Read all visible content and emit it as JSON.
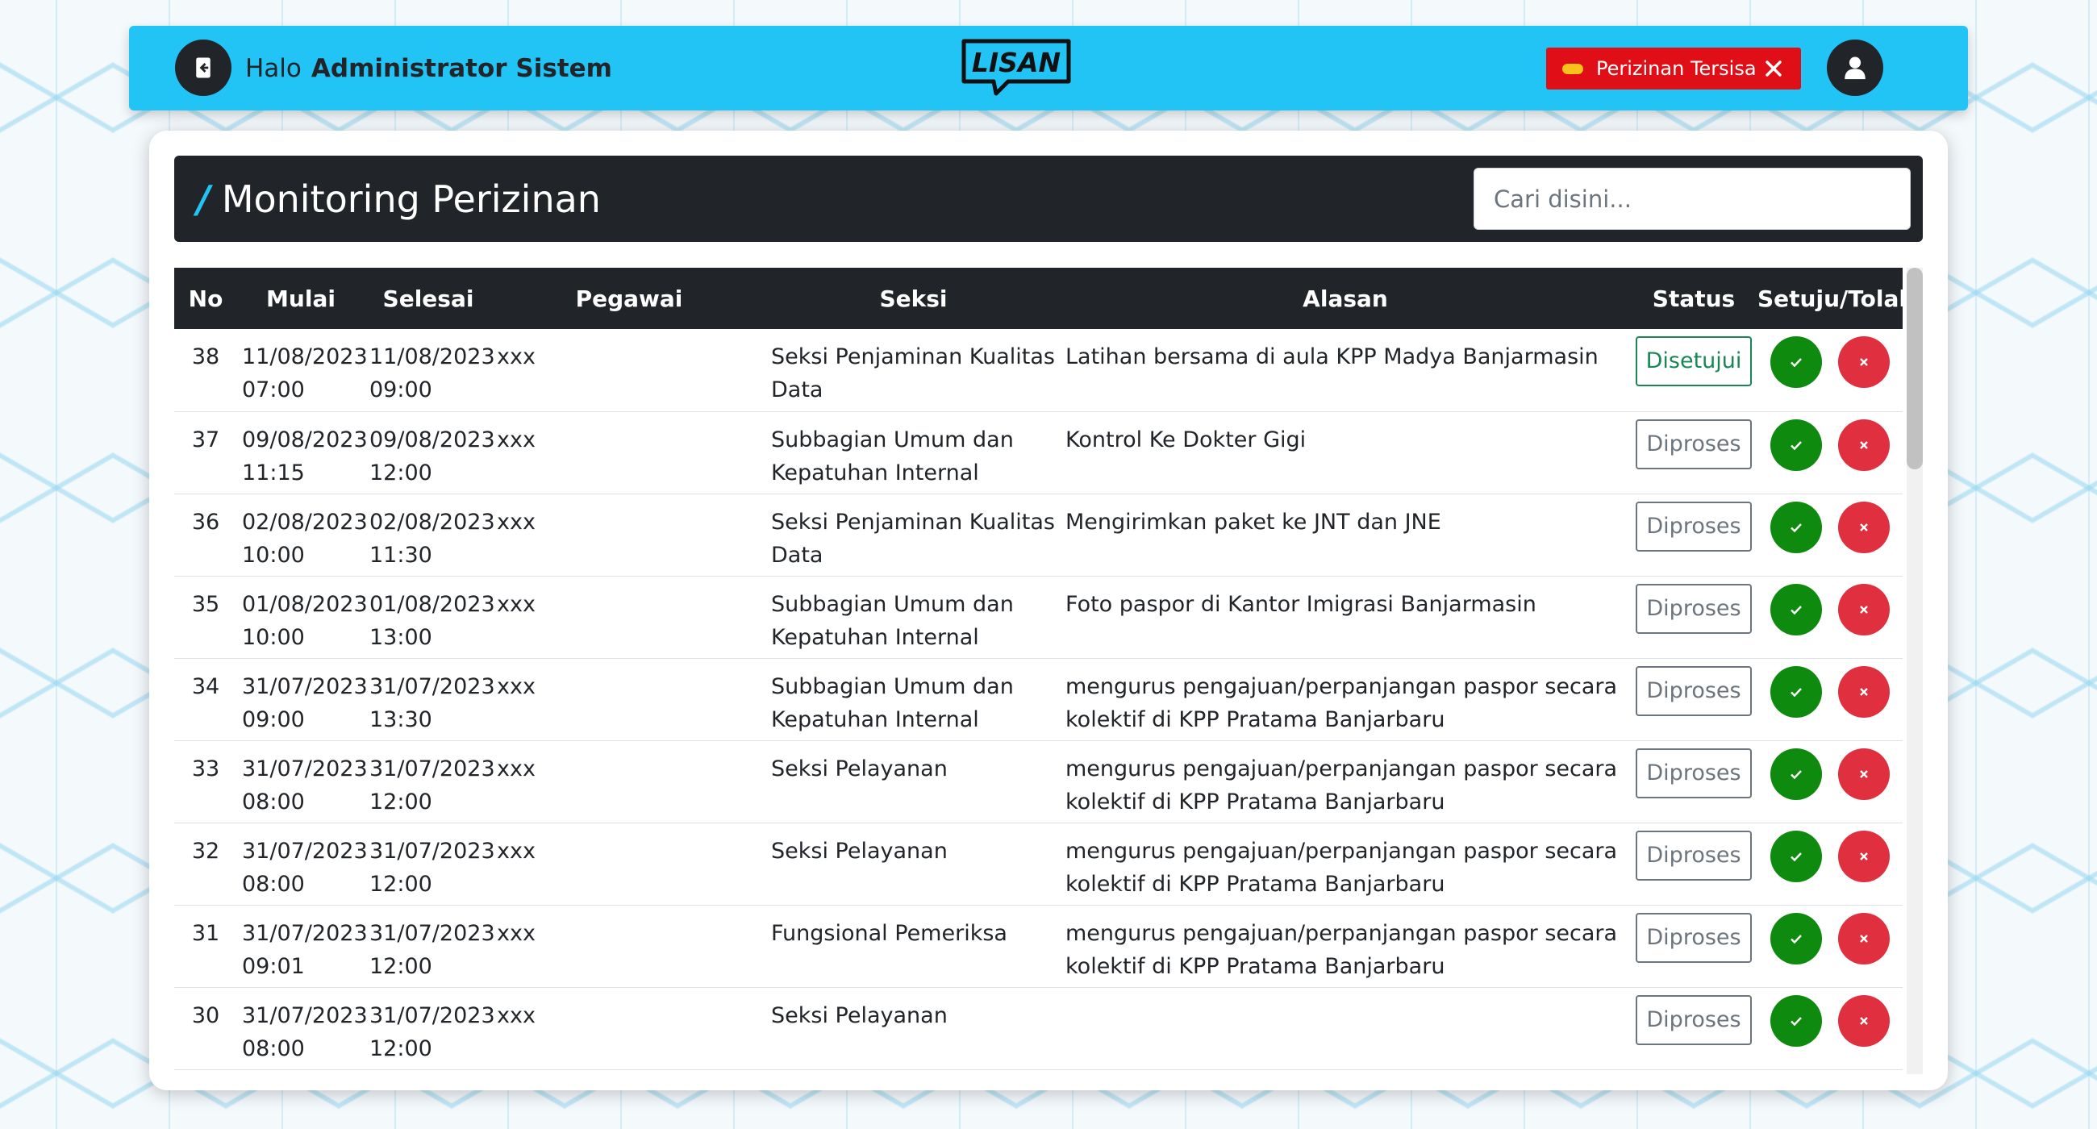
{
  "navbar": {
    "greeting": "Halo",
    "user_name": "Administrator Sistem",
    "logo_text": "LISAN",
    "alert_label": "Perizinan Tersisa",
    "colors": {
      "bar": "#22c4f5",
      "alert": "#e00f17",
      "dark": "#212529"
    }
  },
  "page": {
    "title": "Monitoring Perizinan",
    "search_placeholder": "Cari disini..."
  },
  "table": {
    "headers": {
      "no": "No",
      "mulai": "Mulai",
      "selesai": "Selesai",
      "pegawai": "Pegawai",
      "seksi": "Seksi",
      "alasan": "Alasan",
      "status": "Status",
      "action": "Setuju/Tolak"
    },
    "rows": [
      {
        "no": "38",
        "mulai_date": "11/08/2023",
        "mulai_time": "07:00",
        "selesai_date": "11/08/2023",
        "selesai_time": "09:00",
        "pegawai": "xxx",
        "seksi": "Seksi Penjaminan Kualitas Data",
        "alasan": "Latihan bersama  di aula KPP Madya Banjarmasin",
        "status": "Disetujui"
      },
      {
        "no": "37",
        "mulai_date": "09/08/2023",
        "mulai_time": "11:15",
        "selesai_date": "09/08/2023",
        "selesai_time": "12:00",
        "pegawai": "xxx",
        "seksi": "Subbagian Umum dan Kepatuhan Internal",
        "alasan": "Kontrol Ke Dokter Gigi",
        "status": "Diproses"
      },
      {
        "no": "36",
        "mulai_date": "02/08/2023",
        "mulai_time": "10:00",
        "selesai_date": "02/08/2023",
        "selesai_time": "11:30",
        "pegawai": "xxx",
        "seksi": "Seksi Penjaminan Kualitas Data",
        "alasan": "Mengirimkan paket ke JNT dan JNE",
        "status": "Diproses"
      },
      {
        "no": "35",
        "mulai_date": "01/08/2023",
        "mulai_time": "10:00",
        "selesai_date": "01/08/2023",
        "selesai_time": "13:00",
        "pegawai": "xxx",
        "seksi": "Subbagian Umum dan Kepatuhan Internal",
        "alasan": "Foto paspor di Kantor Imigrasi Banjarmasin",
        "status": "Diproses"
      },
      {
        "no": "34",
        "mulai_date": "31/07/2023",
        "mulai_time": "09:00",
        "selesai_date": "31/07/2023",
        "selesai_time": "13:30",
        "pegawai": "xxx",
        "seksi": "Subbagian Umum dan Kepatuhan Internal",
        "alasan": "mengurus pengajuan/perpanjangan paspor secara kolektif di KPP Pratama Banjarbaru",
        "status": "Diproses"
      },
      {
        "no": "33",
        "mulai_date": "31/07/2023",
        "mulai_time": "08:00",
        "selesai_date": "31/07/2023",
        "selesai_time": "12:00",
        "pegawai": "xxx",
        "seksi": "Seksi Pelayanan",
        "alasan": "mengurus pengajuan/perpanjangan paspor secara kolektif di KPP Pratama Banjarbaru",
        "status": "Diproses"
      },
      {
        "no": "32",
        "mulai_date": "31/07/2023",
        "mulai_time": "08:00",
        "selesai_date": "31/07/2023",
        "selesai_time": "12:00",
        "pegawai": "xxx",
        "seksi": "Seksi Pelayanan",
        "alasan": "mengurus pengajuan/perpanjangan paspor secara kolektif di KPP Pratama Banjarbaru",
        "status": "Diproses"
      },
      {
        "no": "31",
        "mulai_date": "31/07/2023",
        "mulai_time": "09:01",
        "selesai_date": "31/07/2023",
        "selesai_time": "12:00",
        "pegawai": "xxx",
        "seksi": "Fungsional Pemeriksa",
        "alasan": "mengurus pengajuan/perpanjangan paspor secara kolektif di KPP Pratama Banjarbaru",
        "status": "Diproses"
      },
      {
        "no": "30",
        "mulai_date": "31/07/2023",
        "mulai_time": "08:00",
        "selesai_date": "31/07/2023",
        "selesai_time": "12:00",
        "pegawai": "xxx",
        "seksi": "Seksi Pelayanan",
        "alasan": "",
        "status": "Diproses"
      }
    ]
  },
  "icons": {
    "logout": "logout-icon",
    "user": "user-icon",
    "alert_close": "close-icon",
    "approve": "check-icon",
    "reject": "x-icon"
  }
}
